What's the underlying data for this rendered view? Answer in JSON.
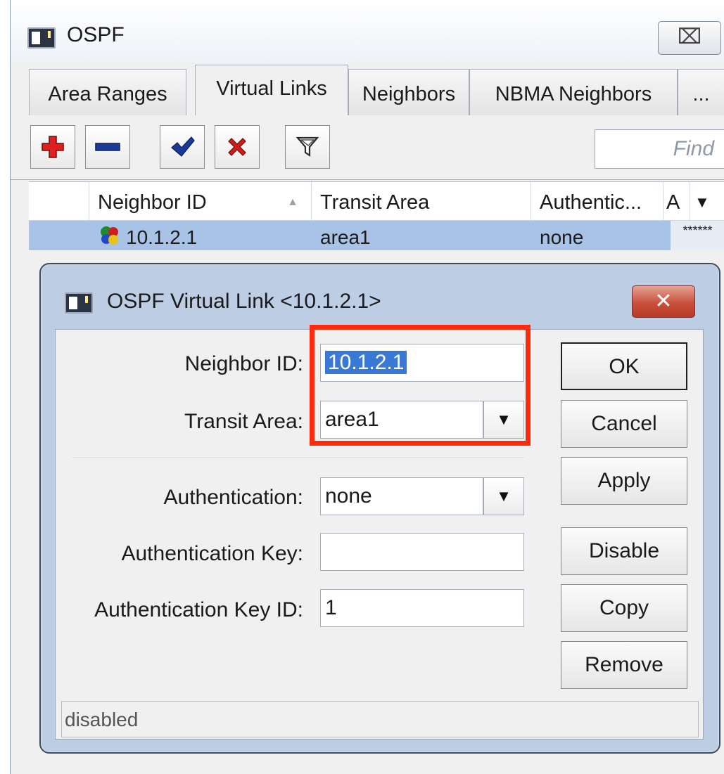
{
  "window": {
    "title": "OSPF",
    "close_label": "⌧"
  },
  "tabs": [
    {
      "label": "Area Ranges"
    },
    {
      "label": "Virtual Links"
    },
    {
      "label": "Neighbors"
    },
    {
      "label": "NBMA Neighbors"
    },
    {
      "label": "..."
    }
  ],
  "toolbar": {
    "find_placeholder": "Find"
  },
  "table": {
    "columns": [
      "Neighbor ID",
      "Transit Area",
      "Authentic...",
      "A"
    ],
    "rows": [
      {
        "neighbor_id": "10.1.2.1",
        "transit_area": "area1",
        "authentication": "none",
        "key": "******"
      }
    ]
  },
  "dialog": {
    "title": "OSPF Virtual Link <10.1.2.1>",
    "close_label": "✕",
    "fields": {
      "neighbor_id": {
        "label": "Neighbor ID:",
        "value": "10.1.2.1"
      },
      "transit_area": {
        "label": "Transit Area:",
        "value": "area1"
      },
      "authentication": {
        "label": "Authentication:",
        "value": "none"
      },
      "auth_key": {
        "label": "Authentication Key:",
        "value": ""
      },
      "auth_key_id": {
        "label": "Authentication Key ID:",
        "value": "1"
      }
    },
    "buttons": {
      "ok": "OK",
      "cancel": "Cancel",
      "apply": "Apply",
      "disable": "Disable",
      "copy": "Copy",
      "remove": "Remove"
    },
    "status": "disabled"
  },
  "colors": {
    "highlight": "#ff2a0d",
    "selected_row": "#a9c3e7",
    "add_icon": "#e02020",
    "remove_icon": "#1a3a9a",
    "check_icon": "#1a3a9a",
    "cross_icon": "#cc1e1e"
  },
  "icons": {
    "window": "window-icon",
    "add": "plus-icon",
    "remove": "minus-icon",
    "enable": "checkmark-icon",
    "disable": "cross-icon",
    "filter": "filter-icon",
    "sort": "sort-arrow-icon",
    "column_menu": "dropdown-arrow-icon",
    "row": "virtual-link-icon",
    "select": "dropdown-arrow-icon"
  }
}
